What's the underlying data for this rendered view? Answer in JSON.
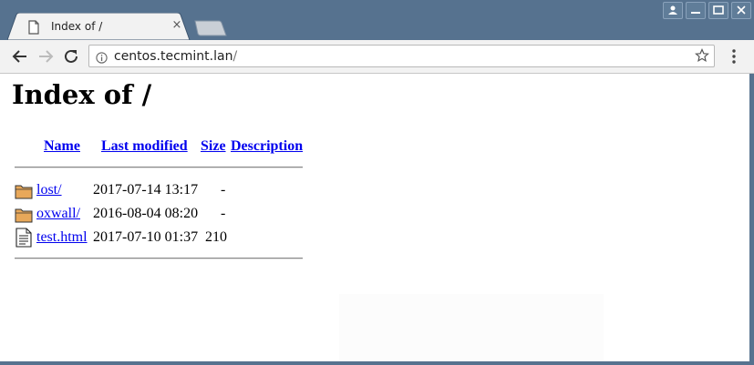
{
  "browser": {
    "tab_title": "Index of /",
    "tab_close": "×",
    "url_host": "centos.tecmint.lan",
    "url_path": "/"
  },
  "page": {
    "heading": "Index of /",
    "columns": {
      "name": "Name",
      "last_modified": "Last modified",
      "size": "Size",
      "description": "Description"
    },
    "entries": [
      {
        "name": "lost/",
        "last_modified": "2017-07-14 13:17",
        "size": "-",
        "icon": "folder-icon"
      },
      {
        "name": "oxwall/",
        "last_modified": "2016-08-04 08:20",
        "size": "-",
        "icon": "folder-icon"
      },
      {
        "name": "test.html",
        "last_modified": "2017-07-10 01:37",
        "size": "210",
        "icon": "text-file-icon"
      }
    ]
  },
  "colors": {
    "frame": "#56728f",
    "link": "#0000ee",
    "toolbar": "#f2f2f2"
  }
}
